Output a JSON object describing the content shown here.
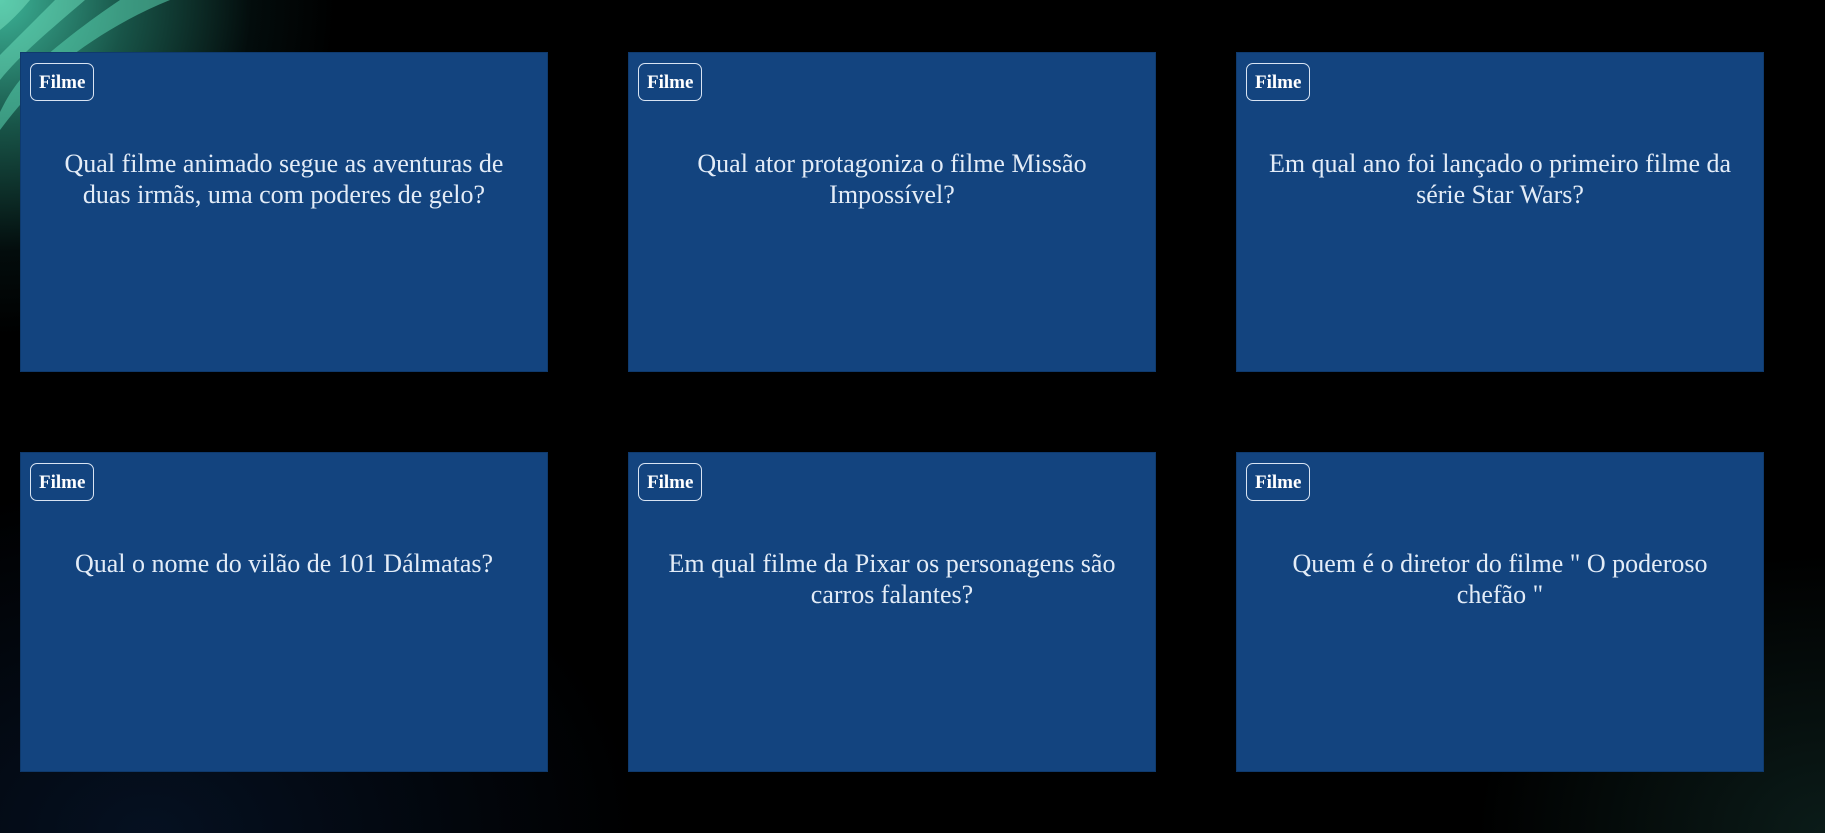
{
  "cards": [
    {
      "category": "Filme",
      "question": "Qual filme animado segue as aventuras de duas irmãs, uma com poderes de gelo?"
    },
    {
      "category": "Filme",
      "question": "Qual ator protagoniza o filme Missão Impossível?"
    },
    {
      "category": "Filme",
      "question": "Em qual ano foi lançado o primeiro filme da série Star Wars?"
    },
    {
      "category": "Filme",
      "question": "Qual o nome do vilão de 101 Dálmatas?"
    },
    {
      "category": "Filme",
      "question": "Em qual filme da Pixar os personagens são carros falantes?"
    },
    {
      "category": "Filme",
      "question": "Quem é o diretor do filme \" O poderoso chefão \""
    }
  ],
  "colors": {
    "card_background": "#13447f",
    "page_background": "#000000",
    "accent_teal": "#40bea0",
    "text": "#e3ecf7"
  }
}
